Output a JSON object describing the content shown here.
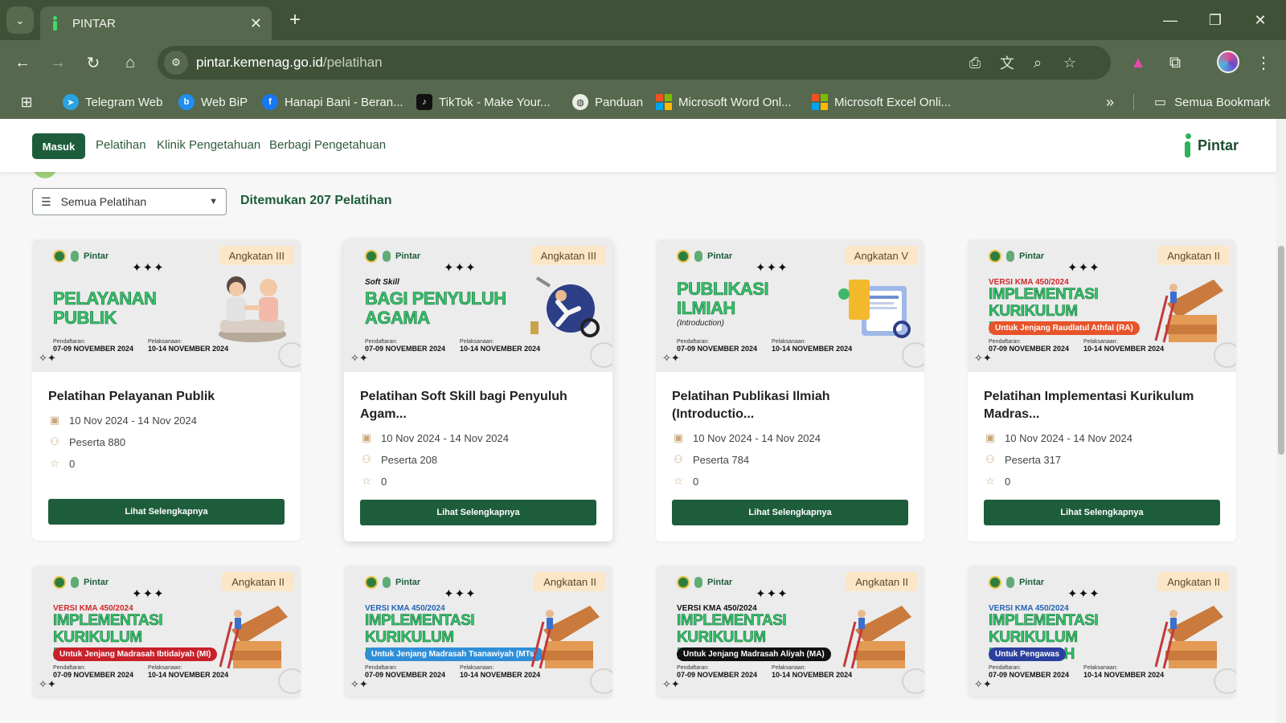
{
  "browser": {
    "tab_title": "PINTAR",
    "url_host": "pintar.kemenag.go.id",
    "url_path": "/pelatihan",
    "bookmarks": [
      {
        "label": "Telegram Web",
        "icon": "telegram-icon",
        "color": "#2aa3e0"
      },
      {
        "label": "Web BiP",
        "icon": "bip-icon",
        "color": "#1e8ff0"
      },
      {
        "label": "Hanapi Bani - Beran...",
        "icon": "facebook-icon",
        "color": "#1877f2"
      },
      {
        "label": "TikTok - Make Your...",
        "icon": "tiktok-icon",
        "color": "#111111"
      },
      {
        "label": "Panduan",
        "icon": "globe-icon",
        "color": "#e8eee4"
      },
      {
        "label": "Microsoft Word Onl...",
        "icon": "microsoft-icon",
        "color": "#f25022"
      },
      {
        "label": "Microsoft Excel Onli...",
        "icon": "microsoft-icon",
        "color": "#f25022"
      }
    ],
    "all_bookmarks": "Semua Bookmark"
  },
  "site": {
    "login": "Masuk",
    "nav": [
      "Pelatihan",
      "Klinik Pengetahuan",
      "Berbagi Pengetahuan"
    ],
    "logo_text": "Pintar",
    "brand_color": "#1e5d3c"
  },
  "filter": {
    "selected": "Semua Pelatihan",
    "found_text": "Ditemukan 207 Pelatihan"
  },
  "banner_common": {
    "logo_text": "Pintar",
    "stars": "✦✦✦",
    "reg_label": "Pendaftaran:",
    "reg_dates": "07-09 NOVEMBER 2024",
    "exec_label": "Pelaksanaan:",
    "exec_dates": "10-14 NOVEMBER 2024"
  },
  "cards": [
    {
      "badge": "Angkatan III",
      "banner_pre": "",
      "banner_title": "PELAYANAN PUBLIK",
      "banner_sub": "",
      "title": "Pelatihan Pelayanan Publik",
      "dates": "10 Nov 2024 - 14 Nov 2024",
      "participants": "Peserta 880",
      "rating": "0",
      "button": "Lihat Selengkapnya"
    },
    {
      "badge": "Angkatan III",
      "banner_pre": "Soft Skill",
      "banner_title": "BAGI PENYULUH AGAMA",
      "banner_sub": "",
      "title": "Pelatihan Soft Skill bagi Penyuluh Agam...",
      "dates": "10 Nov 2024 - 14 Nov 2024",
      "participants": "Peserta 208",
      "rating": "0",
      "button": "Lihat Selengkapnya"
    },
    {
      "badge": "Angkatan V",
      "banner_pre": "",
      "banner_title": "PUBLIKASI ILMIAH",
      "banner_sub": "(Introduction)",
      "title": "Pelatihan Publikasi Ilmiah (Introductio...",
      "dates": "10 Nov 2024 - 14 Nov 2024",
      "participants": "Peserta 784",
      "rating": "0",
      "button": "Lihat Selengkapnya"
    },
    {
      "badge": "Angkatan II",
      "banner_pre": "VERSI KMA 450/2024",
      "banner_title": "IMPLEMENTASI KURIKULUM MADRASAH",
      "banner_sub": "Untuk Jenjang Raudlatul Athfal (RA)",
      "pill_color": "#e8532a",
      "title": "Pelatihan Implementasi Kurikulum Madras...",
      "dates": "10 Nov 2024 - 14 Nov 2024",
      "participants": "Peserta 317",
      "rating": "0",
      "button": "Lihat Selengkapnya"
    },
    {
      "badge": "Angkatan II",
      "banner_pre": "VERSI KMA 450/2024",
      "banner_title": "IMPLEMENTASI KURIKULUM MADRASAH",
      "banner_sub": "Untuk Jenjang Madrasah Ibtidaiyah (MI)",
      "pill_color": "#c8202a"
    },
    {
      "badge": "Angkatan II",
      "banner_pre": "VERSI KMA 450/2024",
      "banner_title": "IMPLEMENTASI KURIKULUM MADRASAH",
      "banner_sub": "Untuk Jenjang Madrasah Tsanawiyah (MTs)",
      "pill_color": "#2f8ed8"
    },
    {
      "badge": "Angkatan II",
      "banner_pre": "VERSI KMA 450/2024",
      "banner_title": "IMPLEMENTASI KURIKULUM MADRASAH",
      "banner_sub": "Untuk Jenjang Madrasah Aliyah (MA)",
      "pill_color": "#111111"
    },
    {
      "badge": "Angkatan II",
      "banner_pre": "VERSI KMA 450/2024",
      "banner_title": "IMPLEMENTASI KURIKULUM MADRASAH",
      "banner_sub": "Untuk Pengawas",
      "pill_color": "#2b3f9e"
    }
  ]
}
